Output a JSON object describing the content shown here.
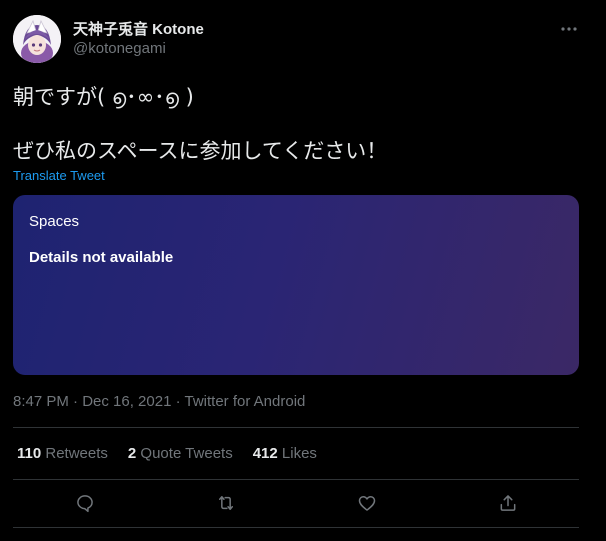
{
  "user": {
    "display_name": "天神子兎音 Kotone",
    "handle": "@kotonegami"
  },
  "tweet": {
    "line1": "朝ですが( ൭･∞･൭ )",
    "line2": "ぜひ私のスペースに参加してください！",
    "translate_label": "Translate Tweet"
  },
  "spaces_card": {
    "label": "Spaces",
    "detail": "Details not available"
  },
  "meta": {
    "text": "8:47 PM · Dec 16, 2021 · Twitter for Android"
  },
  "stats": {
    "retweets_count": "110",
    "retweets_label": "Retweets",
    "quotes_count": "2",
    "quotes_label": "Quote Tweets",
    "likes_count": "412",
    "likes_label": "Likes"
  },
  "actions": {
    "icons": [
      "reply-icon",
      "retweet-icon",
      "like-icon",
      "share-icon"
    ]
  },
  "colors": {
    "background": "#000000",
    "text": "#e7e9ea",
    "secondary": "#71767b",
    "link": "#1d9bf0",
    "divider": "#2f3336"
  }
}
